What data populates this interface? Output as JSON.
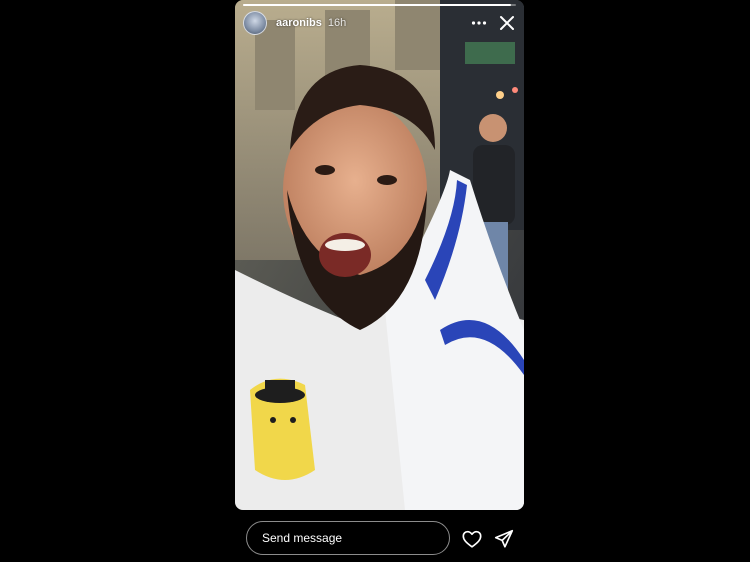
{
  "story": {
    "username": "aaronibs",
    "time": "16h",
    "progress": 0.98,
    "media_description_icon": "story-photo"
  },
  "reply": {
    "placeholder": "Send message"
  },
  "icons": {
    "more": "more-horizontal-icon",
    "close": "close-icon",
    "like": "heart-icon",
    "share": "send-icon"
  }
}
